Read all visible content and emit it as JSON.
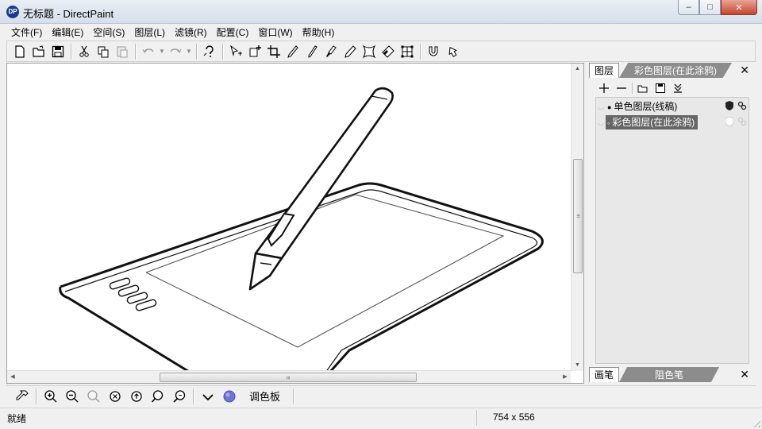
{
  "window": {
    "title": "无标题 - DirectPaint",
    "icon_text": "DP",
    "minimize_glyph": "–",
    "maximize_glyph": "□",
    "close_glyph": "✕"
  },
  "menu": [
    {
      "label": "文件(F)"
    },
    {
      "label": "编辑(E)"
    },
    {
      "label": "空间(S)"
    },
    {
      "label": "图层(L)"
    },
    {
      "label": "滤镜(R)"
    },
    {
      "label": "配置(C)"
    },
    {
      "label": "窗口(W)"
    },
    {
      "label": "帮助(H)"
    }
  ],
  "panel": {
    "tab_layers": "图层",
    "tab_color_layer": "彩色图层(在此涂鸦)",
    "close_glyph": "✕",
    "layers": [
      {
        "name": "单色图层(线稿)",
        "bullet": "●",
        "selected": false
      },
      {
        "name": "彩色图层(在此涂鸦)",
        "bullet": "◦",
        "selected": true
      }
    ],
    "tab_brush": "画笔",
    "tab_eraser": "阻色笔"
  },
  "bottombar": {
    "palette_label": "调色板"
  },
  "status": {
    "message": "就绪",
    "canvas_size": "754 x 556"
  },
  "scroll": {
    "grip_glyph": "≡",
    "up": "▲",
    "down": "▼",
    "left": "◀",
    "right": "▶"
  },
  "icons": {
    "toolbar": [
      "new-file-icon",
      "open-folder-icon",
      "save-icon",
      "cut-icon",
      "copy-icon",
      "paste-icon",
      "undo-icon",
      "redo-icon",
      "help-icon",
      "move-select-icon",
      "transform-icon",
      "crop-icon",
      "pencil-icon",
      "pen-icon",
      "brush-icon",
      "marker-icon",
      "warp-icon",
      "eraser-icon",
      "mesh-icon",
      "magnet-icon",
      "reset-view-icon"
    ],
    "bottom": [
      "color-picker-icon",
      "zoom-in-icon",
      "zoom-out-icon",
      "zoom-disabled-icon",
      "zoom-reset-icon",
      "zoom-fit-icon",
      "zoom-search-icon",
      "zoom-actual-icon",
      "chevron-down-icon",
      "color-swatch-icon"
    ]
  },
  "colors": {
    "swatch": "#6f73d8",
    "selected_layer": "#666666",
    "tab_inactive": "#8c8c8c"
  }
}
